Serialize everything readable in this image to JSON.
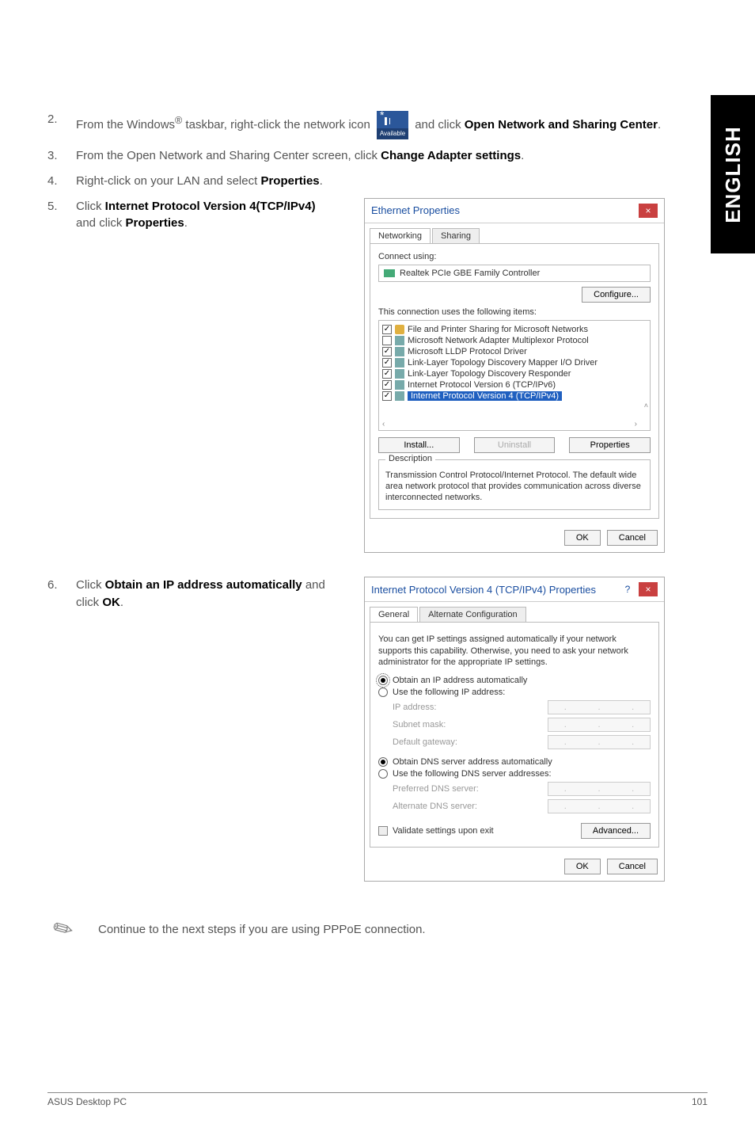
{
  "side_tab": "ENGLISH",
  "steps": {
    "s2": {
      "num": "2.",
      "pre": "From the Windows",
      "reg": "®",
      "mid": " taskbar, right-click the network icon ",
      "iconLabel": "Available",
      "post": " and click ",
      "bold1": "Open Network and Sharing Center",
      "end": "."
    },
    "s3": {
      "num": "3.",
      "text": "From the Open Network and Sharing Center screen, click ",
      "bold": "Change Adapter settings",
      "end": "."
    },
    "s4": {
      "num": "4.",
      "text": "Right-click on your LAN and select ",
      "bold": "Properties",
      "end": "."
    },
    "s5": {
      "num": "5.",
      "pre": "Click ",
      "bold1": "Internet Protocol Version 4(TCP/IPv4)",
      "mid": " and click ",
      "bold2": "Properties",
      "end": "."
    },
    "s6": {
      "num": "6.",
      "pre": "Click ",
      "bold1": "Obtain an IP address automatically",
      "mid": " and click ",
      "bold2": "OK",
      "end": "."
    }
  },
  "dialog1": {
    "title": "Ethernet Properties",
    "tabs": {
      "active": "Networking",
      "other": "Sharing"
    },
    "connect_label": "Connect using:",
    "adapter": "Realtek PCIe GBE Family Controller",
    "configure": "Configure...",
    "uses_label": "This connection uses the following items:",
    "items": [
      {
        "checked": true,
        "icon": "fps",
        "label": "File and Printer Sharing for Microsoft Networks"
      },
      {
        "checked": false,
        "icon": "proto",
        "label": "Microsoft Network Adapter Multiplexor Protocol"
      },
      {
        "checked": true,
        "icon": "proto",
        "label": "Microsoft LLDP Protocol Driver"
      },
      {
        "checked": true,
        "icon": "proto",
        "label": "Link-Layer Topology Discovery Mapper I/O Driver"
      },
      {
        "checked": true,
        "icon": "proto",
        "label": "Link-Layer Topology Discovery Responder"
      },
      {
        "checked": true,
        "icon": "proto",
        "label": "Internet Protocol Version 6 (TCP/IPv6)"
      },
      {
        "checked": true,
        "icon": "proto",
        "label": "Internet Protocol Version 4 (TCP/IPv4)",
        "selected": true
      }
    ],
    "install": "Install...",
    "uninstall": "Uninstall",
    "properties": "Properties",
    "desc_title": "Description",
    "desc_text": "Transmission Control Protocol/Internet Protocol. The default wide area network protocol that provides communication across diverse interconnected networks.",
    "ok": "OK",
    "cancel": "Cancel"
  },
  "dialog2": {
    "title": "Internet Protocol Version 4 (TCP/IPv4) Properties",
    "tabs": {
      "active": "General",
      "other": "Alternate Configuration"
    },
    "intro": "You can get IP settings assigned automatically if your network supports this capability. Otherwise, you need to ask your network administrator for the appropriate IP settings.",
    "r_auto_ip": "Obtain an IP address automatically",
    "r_static_ip": "Use the following IP address:",
    "f_ip": "IP address:",
    "f_mask": "Subnet mask:",
    "f_gw": "Default gateway:",
    "r_auto_dns": "Obtain DNS server address automatically",
    "r_static_dns": "Use the following DNS server addresses:",
    "f_pdns": "Preferred DNS server:",
    "f_adns": "Alternate DNS server:",
    "validate": "Validate settings upon exit",
    "advanced": "Advanced...",
    "ok": "OK",
    "cancel": "Cancel"
  },
  "note": "Continue to the next steps if you are using PPPoE connection.",
  "footer": {
    "left": "ASUS Desktop PC",
    "right": "101"
  }
}
